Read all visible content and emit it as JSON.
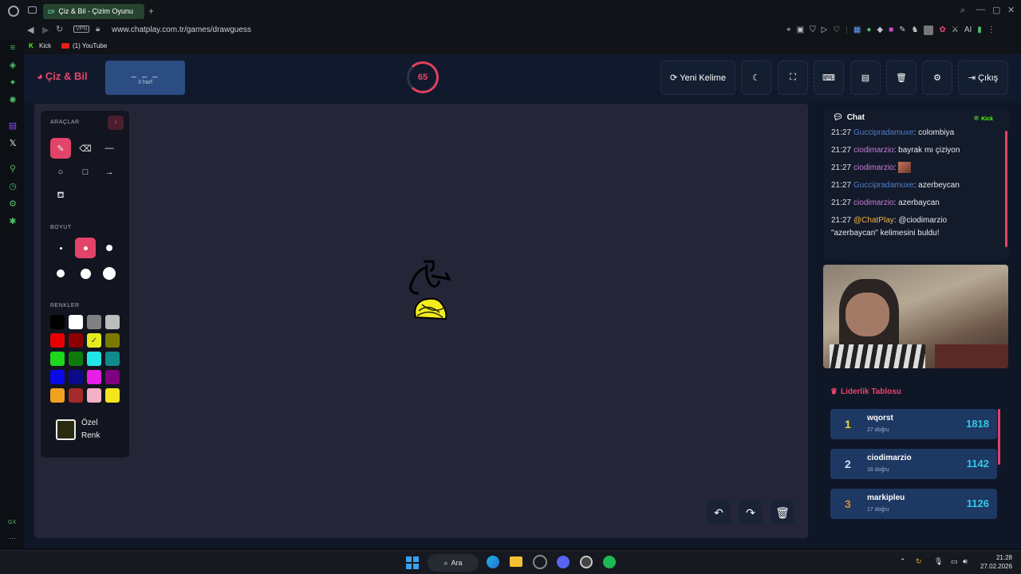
{
  "browser": {
    "tab_title": "Çiz & Bil - Çizim Oyunu",
    "tab_favicon": "CP",
    "vpn_label": "VPN",
    "url": "www.chatplay.com.tr/games/drawguess",
    "ai_label": "AI",
    "bookmarks": [
      "Kick",
      "(1) YouTube"
    ],
    "gx_label": "GX"
  },
  "header": {
    "brand": "Çiz & Bil",
    "word_mask": "_ _ _",
    "word_hint": "3 harf",
    "timer_value": "65",
    "new_word_label": "Yeni Kelime",
    "exit_label": "Çıkış"
  },
  "tools": {
    "title": "ARAÇLAR",
    "size_title": "BOYUT",
    "colors_title": "RENKLER",
    "custom_color_label_1": "Özel",
    "custom_color_label_2": "Renk",
    "custom_color_value": "#2a2a10",
    "palette": [
      "#000000",
      "#ffffff",
      "#808080",
      "#bdbdbd",
      "#e80000",
      "#8b0000",
      "#e6ec1c",
      "#7a7a00",
      "#1ed81e",
      "#0e7a0e",
      "#22e6e6",
      "#108a8a",
      "#0a0ae6",
      "#0a0a8a",
      "#e61ee6",
      "#800080",
      "#f0a21e",
      "#a52a2a",
      "#f4b0c4",
      "#f4e41c"
    ],
    "selected_color": "#e6ec1c"
  },
  "chat": {
    "title": "Chat",
    "platform": "Kick",
    "messages": [
      {
        "time": "21:27",
        "user": "Guccipradamuxe",
        "text": ": colombiya"
      },
      {
        "time": "21:27",
        "user": "ciodimarzio",
        "text": ": bayrak mı çiziyon"
      },
      {
        "time": "21:27",
        "user": "ciodimarzio",
        "text": ":"
      },
      {
        "time": "21:27",
        "user": "Guccipradamuxe",
        "text": ": azerbeycan"
      },
      {
        "time": "21:27",
        "user": "ciodimarzio",
        "text": ": azerbaycan"
      },
      {
        "time": "21:27",
        "user": "@ChatPlay",
        "text": ": @ciodimarzio",
        "text2": "\"azerbaycan\" kelimesini buldu!"
      }
    ]
  },
  "leaderboard": {
    "title": "Liderlik Tablosu",
    "rows": [
      {
        "rank": "1",
        "name": "wqorst",
        "sub": "27 doğru",
        "score": "1818",
        "rank_color": "#f5d231"
      },
      {
        "rank": "2",
        "name": "ciodimarzio",
        "sub": "16 doğru",
        "score": "1142",
        "rank_color": "#d8dde6"
      },
      {
        "rank": "3",
        "name": "markipleu",
        "sub": "17 doğru",
        "score": "1126",
        "rank_color": "#e08a3a"
      }
    ]
  },
  "taskbar": {
    "search_label": "Ara",
    "time": "21:28",
    "date": "27.02.2026"
  },
  "colors": {
    "accent": "#e24368",
    "panel": "#131a2a",
    "canvas": "#242637"
  }
}
